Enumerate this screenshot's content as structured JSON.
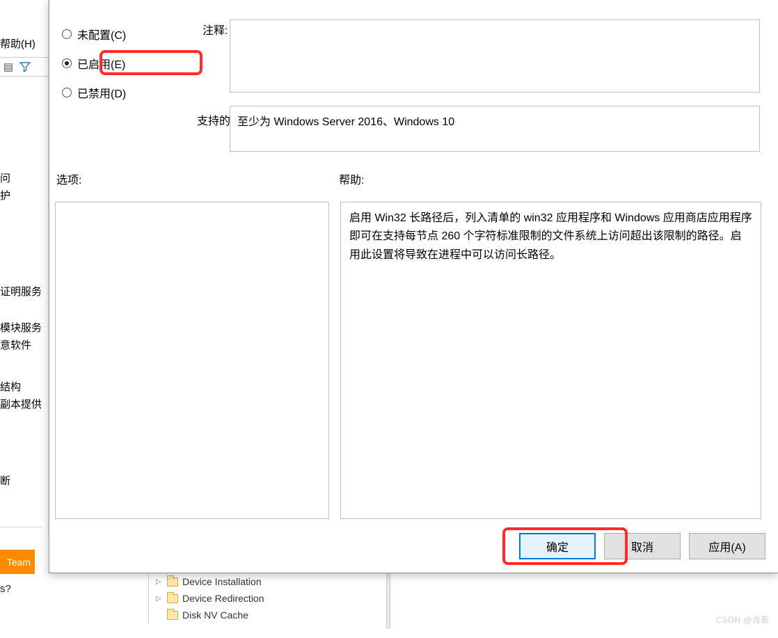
{
  "bg": {
    "menu_help": "帮助(H)",
    "tree": {
      "s1a": "问",
      "s1b": "护",
      "s2": "证明服务",
      "s3a": "模块服务",
      "s3b": "意软件",
      "s4a": "结构",
      "s4b": "副本提供",
      "s5": "断"
    },
    "orange": "Team",
    "question": "s?",
    "bottom_tree": [
      "Device Installation",
      "Device Redirection",
      "Disk NV Cache"
    ]
  },
  "dialog": {
    "radios": {
      "not_configured": "未配置(C)",
      "enabled": "已启用(E)",
      "disabled": "已禁用(D)"
    },
    "labels": {
      "comment": "注释:",
      "platform": "支持的平台:",
      "options": "选项:",
      "help": "帮助:"
    },
    "platform_text": "至少为 Windows Server 2016、Windows 10",
    "help_text": "启用 Win32 长路径后，列入清单的 win32 应用程序和 Windows 应用商店应用程序即可在支持每节点 260 个字符标准限制的文件系统上访问超出该限制的路径。启用此设置将导致在进程中可以访问长路径。",
    "buttons": {
      "ok": "确定",
      "cancel": "取消",
      "apply": "应用(A)"
    }
  },
  "watermark": "CSDN @含影"
}
